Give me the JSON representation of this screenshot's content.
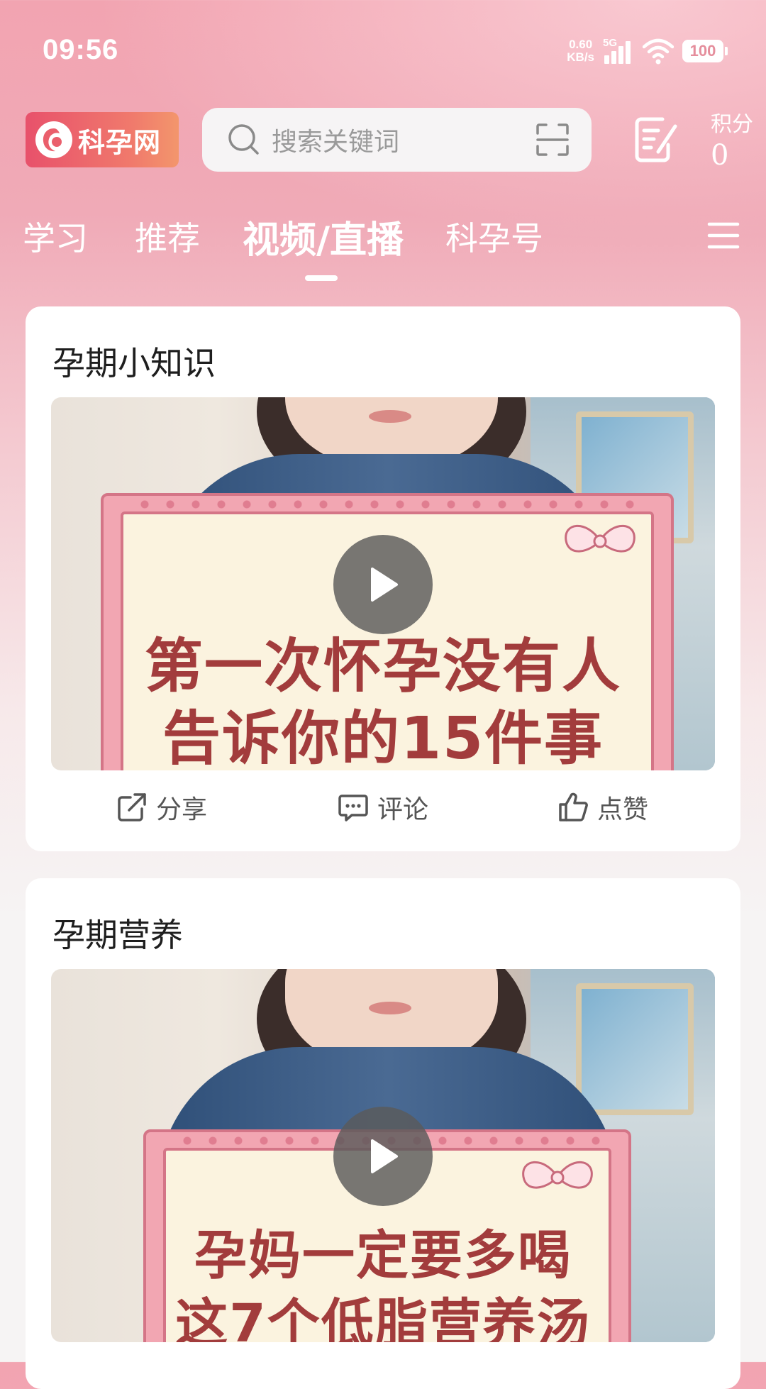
{
  "status_bar": {
    "time": "09:56",
    "net_speed_value": "0.60",
    "net_speed_unit": "KB/s",
    "network_type": "5G",
    "battery": "100"
  },
  "header": {
    "logo_text": "科孕网",
    "search_placeholder": "搜索关键词",
    "points_label": "积分",
    "points_value": "0"
  },
  "tabs": [
    {
      "label": "学习",
      "active": false
    },
    {
      "label": "推荐",
      "active": false
    },
    {
      "label": "视频/直播",
      "active": true
    },
    {
      "label": "科孕号",
      "active": false
    }
  ],
  "cards": [
    {
      "title": "孕期小知识",
      "caption_line1": "第一次怀孕没有人",
      "caption_line2": "告诉你的15件事",
      "actions": {
        "share": "分享",
        "comment": "评论",
        "like": "点赞"
      }
    },
    {
      "title": "孕期营养",
      "caption_line1": "孕妈一定要多喝",
      "caption_line2": "这7个低脂营养汤"
    }
  ],
  "colors": {
    "brand_pink": "#f2a4b1",
    "logo_gradient_start": "#e8516b",
    "logo_gradient_end": "#f3966c",
    "caption_text": "#a23c3c"
  }
}
